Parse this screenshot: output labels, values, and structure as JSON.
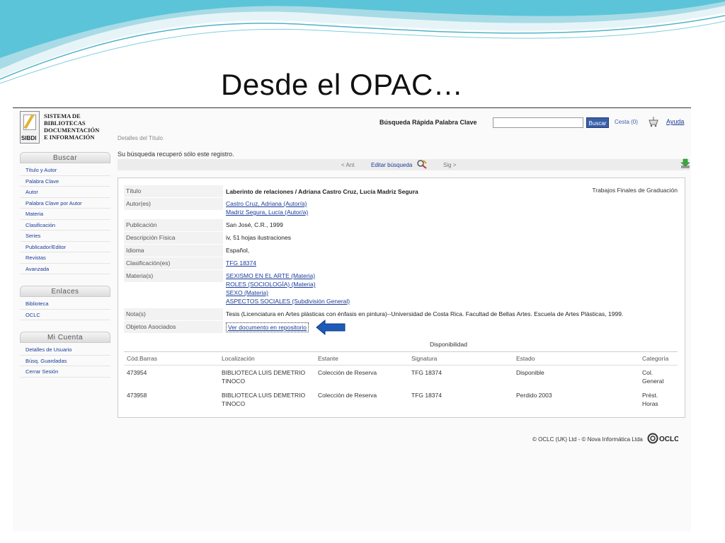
{
  "slide": {
    "title": "Desde el OPAC…"
  },
  "logo": {
    "lines": [
      "SISTEMA DE",
      "BIBLIOTECAS",
      "DOCUMENTACIÓN",
      "E INFORMACIÓN"
    ],
    "brand": "SIBDI"
  },
  "topsearch": {
    "label": "Búsqueda Rápida Palabra Clave",
    "input_value": "",
    "button": "Buscar",
    "cart_label": "Cesta (0)",
    "help": "Ayuda"
  },
  "breadcrumb": "Detalles del Título",
  "result_message": "Su búsqueda recuperó sólo este registro.",
  "record_toolbar": {
    "prev": "< Ant",
    "edit": "Editar búsqueda",
    "next": "Sig >"
  },
  "sidebar": {
    "groups": [
      {
        "title": "Buscar",
        "items": [
          "Título y Autor",
          "Palabra Clave",
          "Autor",
          "Palabra Clave por Autor",
          "Materia",
          "Clasificación",
          "Series",
          "Publicador/Editor",
          "Revistas",
          "Avanzada"
        ]
      },
      {
        "title": "Enlaces",
        "items": [
          "Biblioteca",
          "OCLC"
        ]
      },
      {
        "title": "Mi Cuenta",
        "items": [
          "Detalles de Usuario",
          "Búsq. Guardadas",
          "Cerrar Sesión"
        ]
      }
    ]
  },
  "record": {
    "record_type": "Trabajos Finales de Graduación",
    "fields": {
      "title_label": "Título",
      "title_value": "Laberinto de relaciones / Adriana Castro Cruz, Lucía Madriz Segura",
      "authors_label": "Autor(es)",
      "authors": [
        "Castro Cruz, Adriana (Autor/a)",
        "Madriz Segura, Lucía (Autor/a)"
      ],
      "publication_label": "Publicación",
      "publication_value": "San José, C.R., 1999",
      "physical_label": "Descripción Física",
      "physical_value": "iv, 51 hojas ilustraciones",
      "language_label": "Idioma",
      "language_value": "Español,",
      "classification_label": "Clasificación(es)",
      "classification_value": "TFG 18374",
      "subjects_label": "Materia(s)",
      "subjects": [
        "SEXISMO EN EL ARTE (Materia)",
        "ROLES (SOCIOLOGÍA) (Materia)",
        "SEXO (Materia)",
        "ASPECTOS SOCIALES (Subdivisión General)"
      ],
      "notes_label": "Nota(s)",
      "notes_value": "Tesis (Licenciatura en Artes plásticas con énfasis en pintura)--Universidad de Costa Rica. Facultad de Bellas Artes. Escuela de Artes Plásticas, 1999.",
      "objects_label": "Objetos Asociados",
      "objects_value": "Ver documento en repositorio"
    },
    "availability_title": "Disponibilidad",
    "availability": {
      "headers": [
        "Cód.Barras",
        "Localización",
        "Estante",
        "Signatura",
        "Estado",
        "Categoría"
      ],
      "rows": [
        {
          "barcode": "473954",
          "location": "BIBLIOTECA LUIS DEMETRIO TINOCO",
          "shelf": "Colección de Reserva",
          "call": "TFG 18374",
          "status": "Disponible",
          "category": "Col. General"
        },
        {
          "barcode": "473958",
          "location": "BIBLIOTECA LUIS DEMETRIO TINOCO",
          "shelf": "Colección de Reserva",
          "call": "TFG 18374",
          "status": "Perdido 2003",
          "category": "Prést. Horas"
        }
      ]
    }
  },
  "footer": {
    "text": "© OCLC (UK) Ltd - © Nova Informática Ltda",
    "oclc": "OCLC"
  },
  "colors": {
    "wave_primary": "#5bc4d8",
    "wave_light": "#bfe6ef",
    "link": "#1a3c9a",
    "button": "#3a5fa8",
    "arrow": "#1d5bb8"
  }
}
